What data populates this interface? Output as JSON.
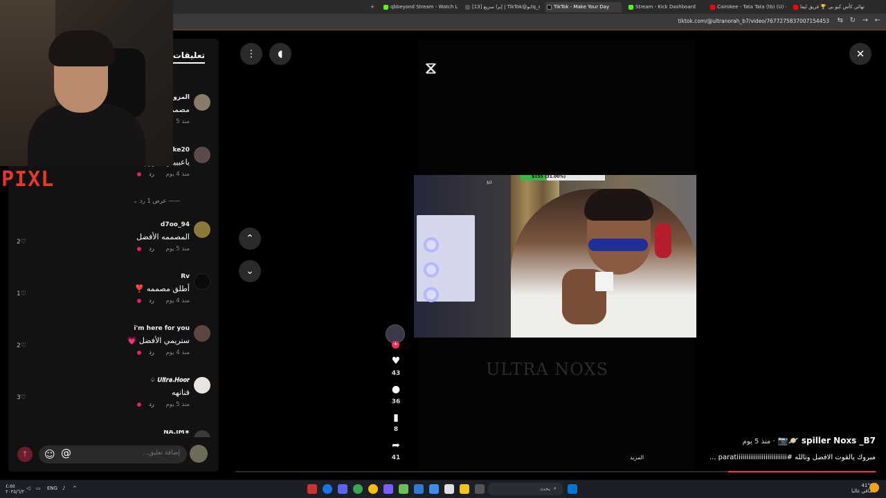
{
  "browser": {
    "tabs": [
      {
        "label": "qbbeyond Stream - Watch Live",
        "color": "#53fc18"
      },
      {
        "label": "[13] إبرا سريع | TikTok@بوtq_ai",
        "color": "#000000"
      },
      {
        "label": "TikTok - Make Your Day",
        "color": "#000000"
      },
      {
        "label": "Stream - Kick Dashboard",
        "color": "#53fc18"
      },
      {
        "label": "Cairokee - Tata Tata (tb) (U) -- ت",
        "color": "#ff0000"
      },
      {
        "label": "نهائي كأس كيو بي 🏆 فريق ليفا",
        "color": "#ff0000"
      }
    ],
    "new_tab": "+",
    "url": "tiktok.com/@ultranorah_b7/video/7677275837007154453"
  },
  "overlay": {
    "logo": "PIXL"
  },
  "comments": {
    "title": "تعليقات",
    "view_replies": "عرض 1 رد",
    "reply_label": "رد",
    "items": [
      {
        "user": "المزون",
        "text": "مصمم",
        "time": "منذ 5",
        "likes": "",
        "avatar": "#8a7a6a"
      },
      {
        "user": "ke20",
        "text": "ياعيييني يابوورهه💗💗",
        "time": "منذ 4 يوم",
        "likes": "",
        "avatar": "#5a4a4a"
      },
      {
        "user": "d7oo_94",
        "text": "المصممه الأفضل",
        "time": "منذ 5 يوم",
        "likes": "2",
        "avatar": "#8a7a3a"
      },
      {
        "user": "Rv",
        "text": "أطلق مصممه ❣️",
        "time": "منذ 4 يوم",
        "likes": "1",
        "avatar": "#0a0a0a"
      },
      {
        "user": "i'm here for you",
        "text": "ستريمي الأفضل 💗",
        "time": "منذ 4 يوم",
        "likes": "2",
        "avatar": "#5a4840"
      },
      {
        "user": "𝑼𝒍𝒕𝒓𝒂.𝑯𝒐𝒐𝒓 ♤",
        "text": "فنانهه",
        "time": "منذ 5 يوم",
        "likes": "3",
        "avatar": "#e8e4e0"
      },
      {
        "user": "∗NA.IM",
        "text": "",
        "time": "",
        "likes": "",
        "avatar": "#3a3a3a"
      }
    ],
    "input_placeholder": "إضافة تعليق...",
    "emoji_icon": "☺",
    "at_icon": "@",
    "send_icon": "↑"
  },
  "player": {
    "stream_money": "$155 (31.00%)",
    "stream_zero": "$0",
    "stream_progress": 0.31,
    "watermark": "ULTRA NOXS",
    "more_label": "المزيد",
    "likes": "43",
    "comments": "36",
    "saves": "8",
    "shares": "41",
    "author": "spiller Noxs _B7 🪐📷",
    "ago": "· منذ 5 يوم",
    "caption": "مبروك يالقوت الافضل وتالله #paratiiiiiiiiiiiiiiiiiiiiiiiiii ...",
    "progress": 0.23
  },
  "taskbar": {
    "search_placeholder": "بحث",
    "weather": "41°C",
    "weather_desc": "صافي غالبا",
    "lang": "ENG",
    "time": "٤:٥٥",
    "date": "٢٠٢٥/٦/٢٠"
  }
}
